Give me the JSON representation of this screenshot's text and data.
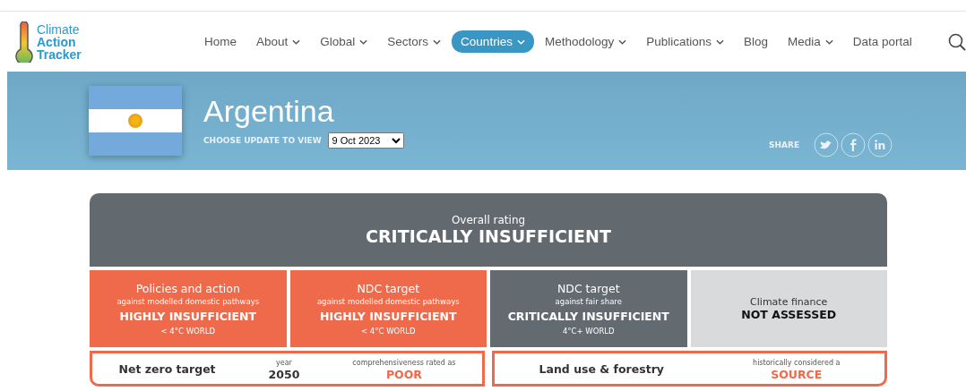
{
  "logo": {
    "lines": [
      "Climate",
      "Action",
      "Tracker"
    ]
  },
  "nav": [
    {
      "label": "Home",
      "dropdown": false,
      "selected": false
    },
    {
      "label": "About",
      "dropdown": true,
      "selected": false
    },
    {
      "label": "Global",
      "dropdown": true,
      "selected": false
    },
    {
      "label": "Sectors",
      "dropdown": true,
      "selected": false
    },
    {
      "label": "Countries",
      "dropdown": true,
      "selected": true
    },
    {
      "label": "Methodology",
      "dropdown": true,
      "selected": false
    },
    {
      "label": "Publications",
      "dropdown": true,
      "selected": false
    },
    {
      "label": "Blog",
      "dropdown": false,
      "selected": false
    },
    {
      "label": "Media",
      "dropdown": true,
      "selected": false
    },
    {
      "label": "Data portal",
      "dropdown": false,
      "selected": false
    }
  ],
  "banner": {
    "country": "Argentina",
    "update_label": "CHOOSE UPDATE TO VIEW",
    "update_value": "9 Oct 2023",
    "share_label": "SHARE"
  },
  "overall": {
    "caption": "Overall rating",
    "rating": "CRITICALLY INSUFFICIENT"
  },
  "tiles": [
    {
      "kind": "rated",
      "color": "#ee6a4b",
      "title": "Policies and action",
      "subtitle": "against modelled domestic pathways",
      "rating": "HIGHLY INSUFFICIENT",
      "world": "< 4°C WORLD"
    },
    {
      "kind": "rated",
      "color": "#ee6a4b",
      "title": "NDC target",
      "subtitle": "against modelled domestic pathways",
      "rating": "HIGHLY INSUFFICIENT",
      "world": "< 4°C WORLD"
    },
    {
      "kind": "rated",
      "color": "#636b71",
      "title": "NDC target",
      "subtitle": "against fair share",
      "rating": "CRITICALLY INSUFFICIENT",
      "world": "4°C+ WORLD"
    },
    {
      "kind": "not_assessed",
      "color": "#d8dadb",
      "title": "Climate finance",
      "rating": "NOT ASSESSED"
    }
  ],
  "targets": [
    {
      "label": "Net zero target",
      "facts": [
        {
          "caption": "year",
          "value": "2050",
          "accent": false
        },
        {
          "caption": "comprehensiveness rated as",
          "value": "POOR",
          "accent": true
        }
      ]
    },
    {
      "label": "Land use & forestry",
      "facts": [
        {
          "caption": "historically considered a",
          "value": "SOURCE",
          "accent": true
        }
      ]
    }
  ]
}
